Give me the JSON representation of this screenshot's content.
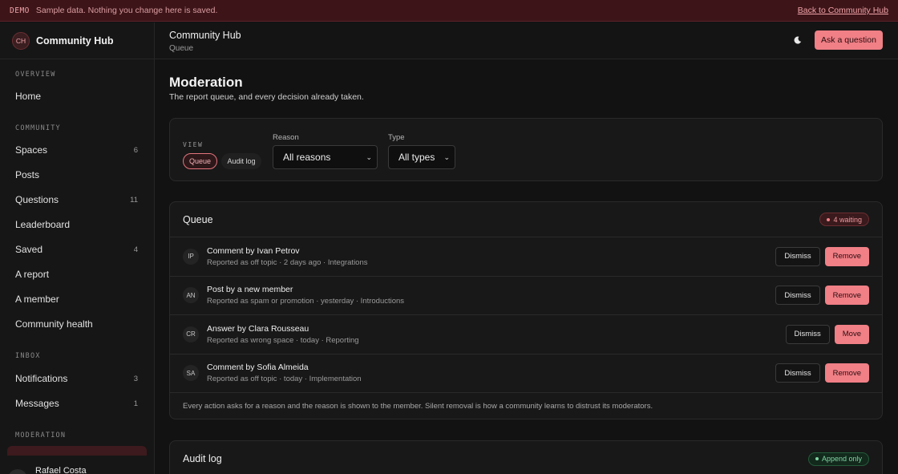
{
  "demo": {
    "tag": "DEMO",
    "text": "Sample data. Nothing you change here is saved.",
    "link": "Back to Community Hub"
  },
  "brand": {
    "initials": "CH",
    "name": "Community Hub"
  },
  "sidebar": {
    "sections": [
      "OVERVIEW",
      "COMMUNITY",
      "INBOX",
      "MODERATION"
    ],
    "items": [
      {
        "label": "Home",
        "count": ""
      },
      {
        "label": "Spaces",
        "count": "6"
      },
      {
        "label": "Posts",
        "count": ""
      },
      {
        "label": "Questions",
        "count": "11"
      },
      {
        "label": "Leaderboard",
        "count": ""
      },
      {
        "label": "Saved",
        "count": "4"
      },
      {
        "label": "A report",
        "count": ""
      },
      {
        "label": "A member",
        "count": ""
      },
      {
        "label": "Community health",
        "count": ""
      },
      {
        "label": "Notifications",
        "count": "3"
      },
      {
        "label": "Messages",
        "count": "1"
      }
    ],
    "user": {
      "initials": "RC",
      "name": "Rafael Costa"
    }
  },
  "header": {
    "title": "Community Hub",
    "subtitle": "Queue",
    "ask_label": "Ask a question"
  },
  "page": {
    "title": "Moderation",
    "subtitle": "The report queue, and every decision already taken."
  },
  "filters": {
    "view_label": "VIEW",
    "views": [
      "Queue",
      "Audit log"
    ],
    "reason_label": "Reason",
    "reason_value": "All reasons",
    "type_label": "Type",
    "type_value": "All types"
  },
  "queue": {
    "title": "Queue",
    "badge": "4 waiting",
    "rows": [
      {
        "initials": "IP",
        "title": "Comment by Ivan Petrov",
        "meta": "Reported as off topic · 2 days ago · Integrations",
        "dismiss": "Dismiss",
        "action": "Remove"
      },
      {
        "initials": "AN",
        "title": "Post by a new member",
        "meta": "Reported as spam or promotion · yesterday · Introductions",
        "dismiss": "Dismiss",
        "action": "Remove"
      },
      {
        "initials": "CR",
        "title": "Answer by Clara Rousseau",
        "meta": "Reported as wrong space · today · Reporting",
        "dismiss": "Dismiss",
        "action": "Move"
      },
      {
        "initials": "SA",
        "title": "Comment by Sofia Almeida",
        "meta": "Reported as off topic · today · Implementation",
        "dismiss": "Dismiss",
        "action": "Remove"
      }
    ],
    "footer": "Every action asks for a reason and the reason is shown to the member. Silent removal is how a community learns to distrust its moderators."
  },
  "audit": {
    "title": "Audit log",
    "badge": "Append only"
  },
  "colors": {
    "accent": "#f07f86",
    "demo_bg": "#3d1519",
    "success": "#7fd5a2"
  }
}
